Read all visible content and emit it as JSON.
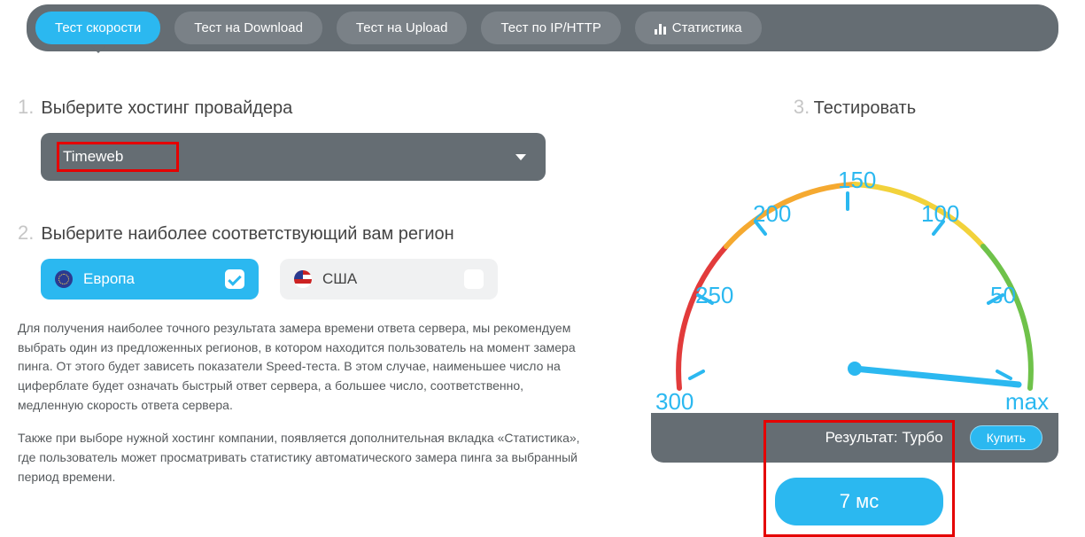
{
  "tabs": {
    "speed": "Тест скорости",
    "download": "Тест на Download",
    "upload": "Тест на Upload",
    "iphttp": "Тест по IP/HTTP",
    "stats": "Статистика"
  },
  "step1": {
    "num": "1.",
    "title": "Выберите хостинг провайдера"
  },
  "provider": {
    "value": "Timeweb"
  },
  "step2": {
    "num": "2.",
    "title": "Выберите наиболее соответствующий вам регион"
  },
  "regions": {
    "europe": "Европа",
    "usa": "США"
  },
  "desc1": "Для получения наиболее точного результата замера времени ответа сервера, мы рекомендуем выбрать один из предложенных регионов, в котором находится пользователь на момент замера пинга. От этого будет зависеть показатели Speed-теста. В этом случае, наименьшее число на циферблате будет означать быстрый ответ сервера, а большее число, соответственно, медленную скорость ответа сервера.",
  "desc2": "Также при выборе нужной хостинг компании, появляется дополнительная вкладка «Статистика», где пользователь может просматривать статистику автоматического замера пинга за выбранный период времени.",
  "step3": {
    "num": "3.",
    "title": "Тестировать"
  },
  "gauge": {
    "t300": "300",
    "t250": "250",
    "t200": "200",
    "t150": "150",
    "t100": "100",
    "t50": "50",
    "tmax": "max"
  },
  "result": {
    "label": "Результат: Турбо",
    "buy": "Купить",
    "value": "7 мс"
  },
  "chart_data": {
    "type": "gauge",
    "ticks": [
      300,
      250,
      200,
      150,
      100,
      50,
      "max"
    ],
    "value_ms": 7,
    "value_label": "Турбо",
    "needle_near": "max"
  }
}
